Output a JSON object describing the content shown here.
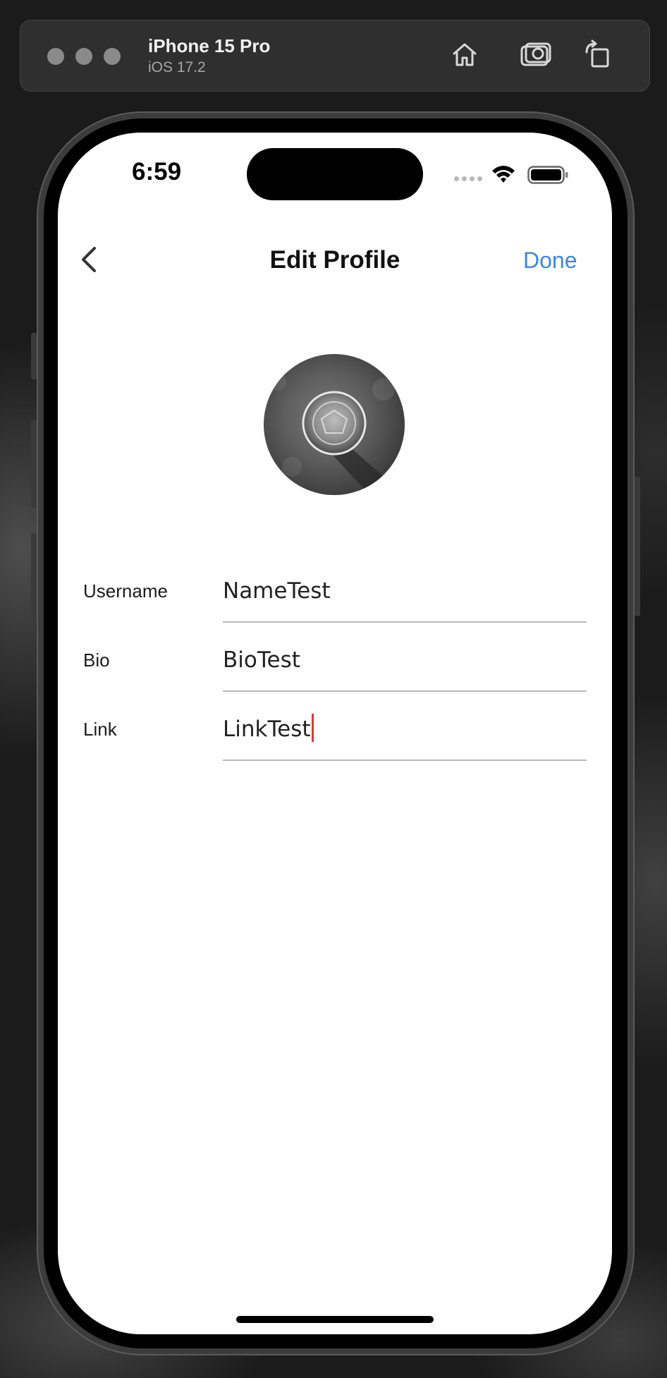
{
  "simulator": {
    "device_name": "iPhone 15 Pro",
    "os_version": "iOS 17.2",
    "toolbar_icons": [
      "home-icon",
      "screenshot-icon",
      "rotate-icon"
    ]
  },
  "status_bar": {
    "time": "6:59",
    "icons": [
      "cellular-signal-icon",
      "wifi-icon",
      "battery-icon"
    ]
  },
  "nav": {
    "title": "Edit Profile",
    "done_label": "Done",
    "back_icon": "chevron-left-icon"
  },
  "form": {
    "fields": [
      {
        "label": "Username",
        "value": "NameTest"
      },
      {
        "label": "Bio",
        "value": "BioTest"
      },
      {
        "label": "Link",
        "value": "LinkTest"
      }
    ]
  },
  "colors": {
    "accent": "#3d86e0",
    "caret": "#d63b3b"
  }
}
